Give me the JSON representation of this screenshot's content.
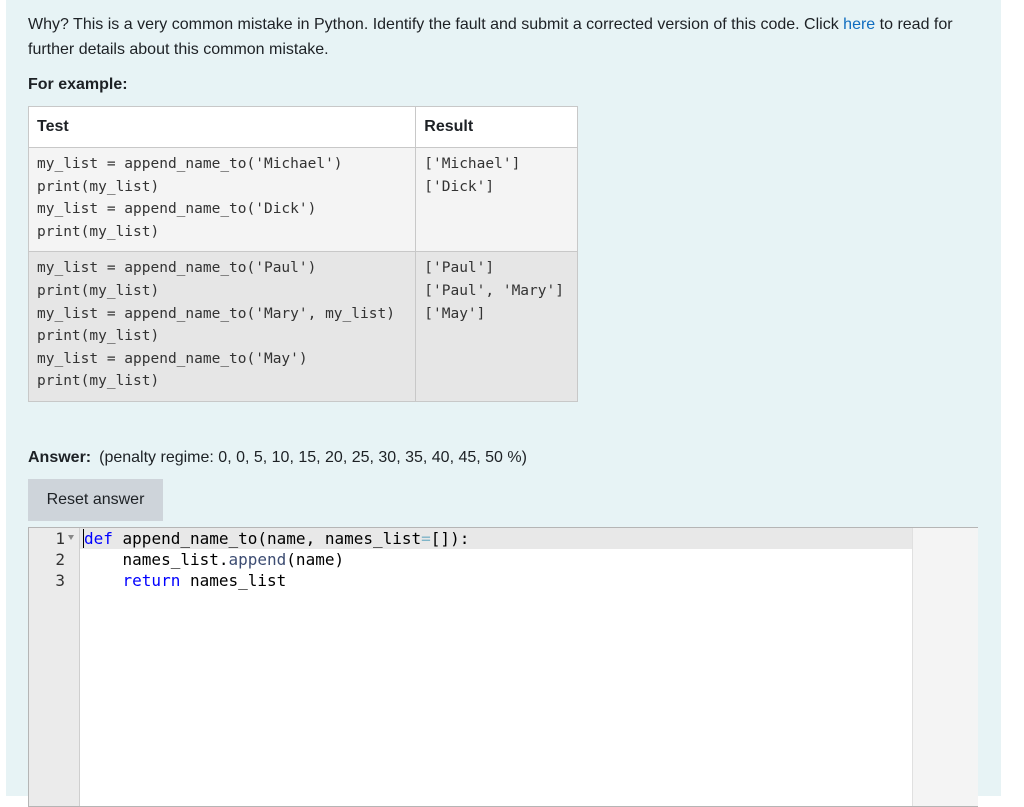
{
  "intro": {
    "text_before_link": "Why? This is a very common mistake in Python. Identify the fault and submit a corrected version of this code. Click ",
    "link_text": "here",
    "text_after_link": " to read for further details about this common mistake."
  },
  "for_example_label": "For example:",
  "examples_table": {
    "headers": [
      "Test",
      "Result"
    ],
    "rows": [
      {
        "test": "my_list = append_name_to('Michael')\nprint(my_list)\nmy_list = append_name_to('Dick')\nprint(my_list)",
        "result": "['Michael']\n['Dick']"
      },
      {
        "test": "my_list = append_name_to('Paul')\nprint(my_list)\nmy_list = append_name_to('Mary', my_list)\nprint(my_list)\nmy_list = append_name_to('May')\nprint(my_list)",
        "result": "['Paul']\n['Paul', 'Mary']\n['May']"
      }
    ]
  },
  "answer": {
    "label": "Answer:",
    "penalty": "(penalty regime: 0, 0, 5, 10, 15, 20, 25, 30, 35, 40, 45, 50 %)"
  },
  "reset_button_label": "Reset answer",
  "editor": {
    "line_numbers": [
      "1",
      "2",
      "3"
    ],
    "code": {
      "l1_kw": "def",
      "l1_rest": " append_name_to(name, names_list",
      "l1_op": "=",
      "l1_end": "[]):",
      "l2_indent": "    names_list.",
      "l2_fn": "append",
      "l2_end": "(name)",
      "l3_indent": "    ",
      "l3_kw": "return",
      "l3_end": " names_list"
    }
  },
  "colors": {
    "panel_bg": "#e7f3f5",
    "link": "#0f6cbf",
    "keyword": "#0000ff",
    "button_bg": "#ced4da"
  }
}
